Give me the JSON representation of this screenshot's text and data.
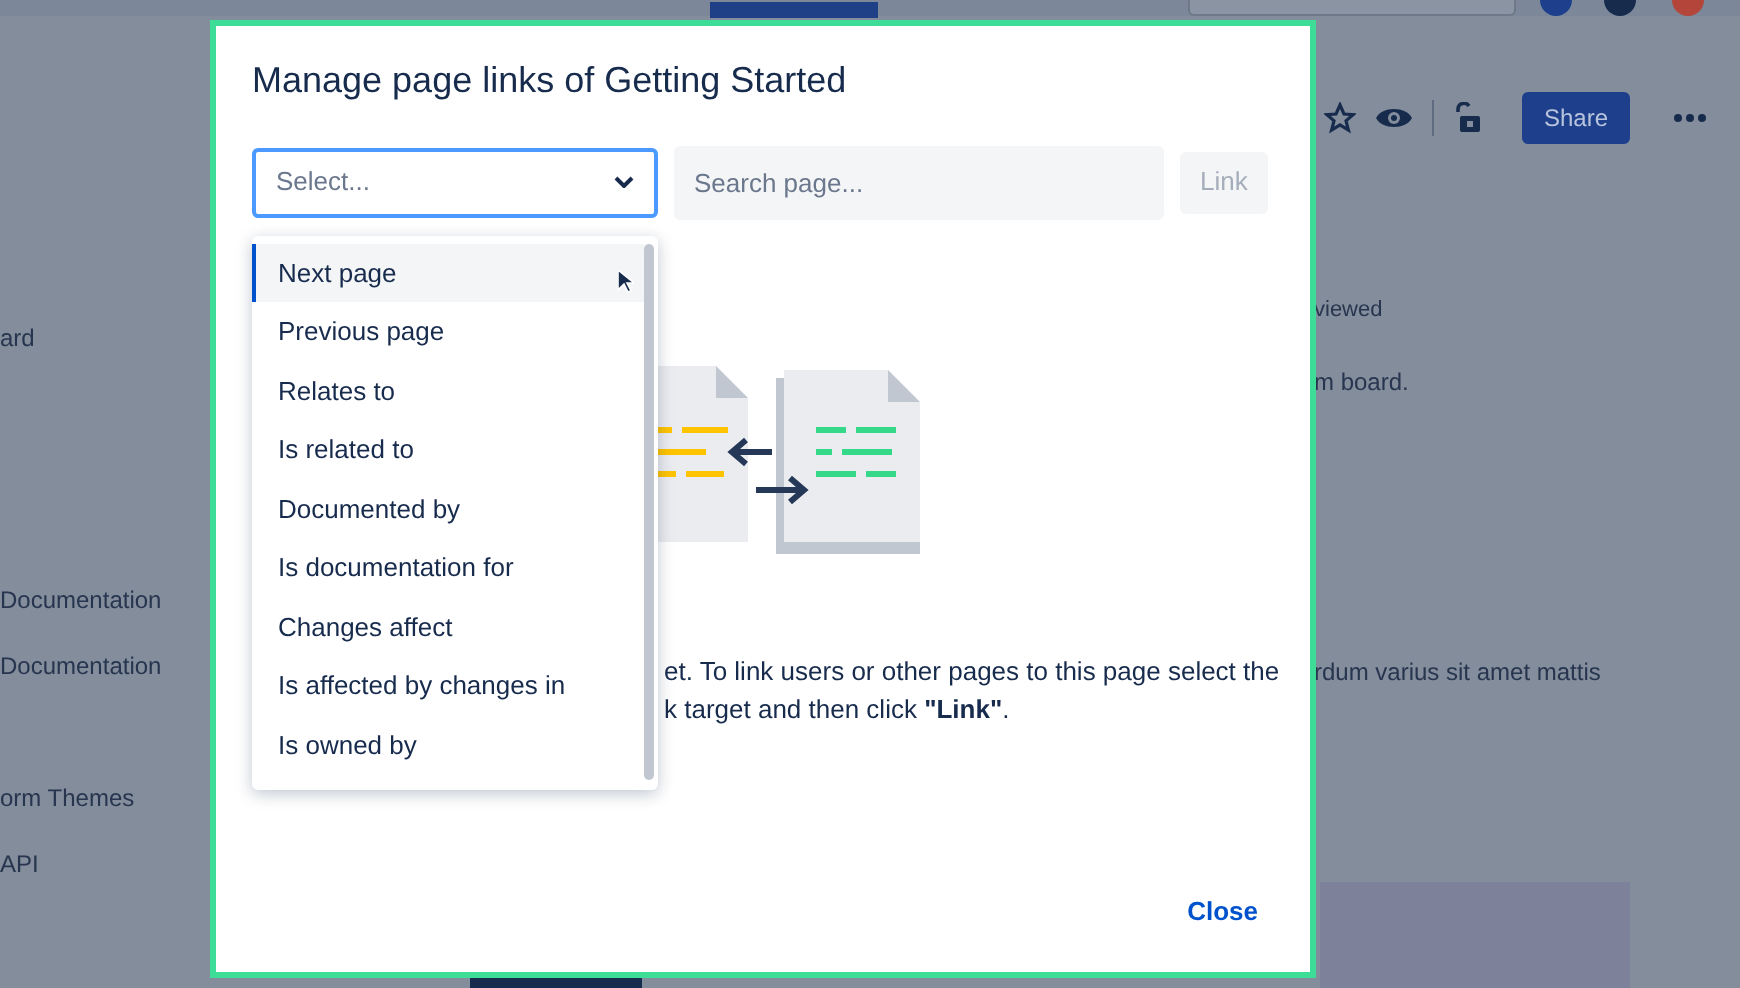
{
  "sidebar": {
    "items": [
      "ard",
      "Documentation",
      "Documentation",
      "orm Themes",
      "API"
    ]
  },
  "page": {
    "toolbar": {
      "share_button": "Share"
    },
    "texts": [
      "viewed",
      "m board.",
      "rdum varius sit amet mattis"
    ]
  },
  "dialog": {
    "title": "Manage page links of Getting Started",
    "select": {
      "placeholder": "Select..."
    },
    "search": {
      "placeholder": "Search page..."
    },
    "link_button": {
      "label": "Link",
      "disabled": true
    },
    "dropdown": [
      {
        "label": "Next page",
        "selected": true
      },
      {
        "label": "Previous page",
        "selected": false
      },
      {
        "label": "Relates to",
        "selected": false
      },
      {
        "label": "Is related to",
        "selected": false
      },
      {
        "label": "Documented by",
        "selected": false
      },
      {
        "label": "Is documentation for",
        "selected": false
      },
      {
        "label": "Changes affect",
        "selected": false
      },
      {
        "label": "Is affected by changes in",
        "selected": false
      },
      {
        "label": "Is owned by",
        "selected": false
      }
    ],
    "message_lines": [
      "et. To link users or other pages to this page select the",
      "k target and then click **\"Link\"**."
    ],
    "close_button": "Close"
  }
}
